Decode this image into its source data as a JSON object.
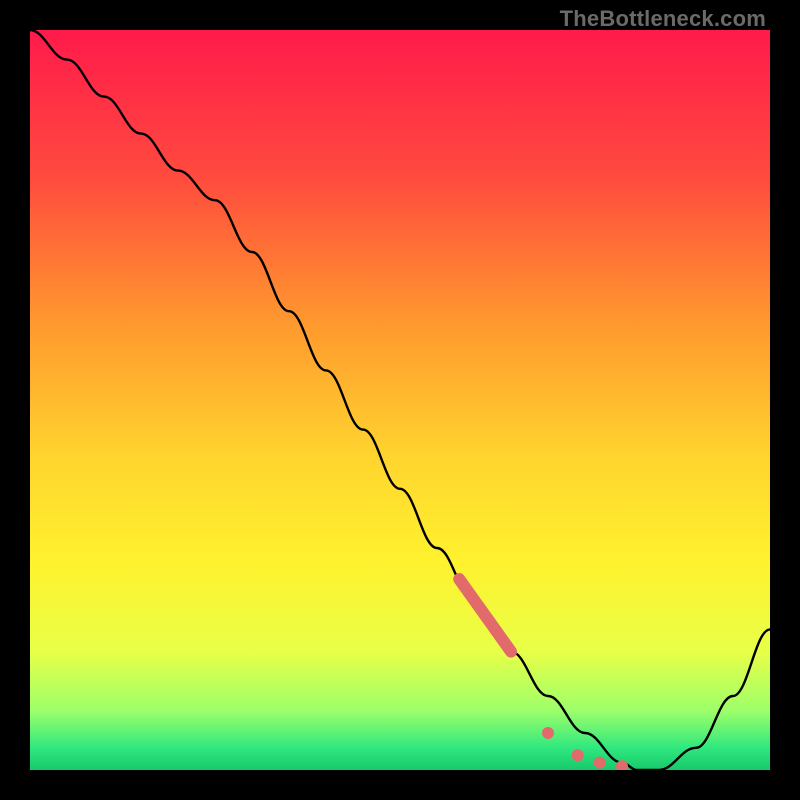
{
  "watermark": "TheBottleneck.com",
  "colors": {
    "frame": "#000000",
    "curve": "#000000",
    "marker": "#e26a6a",
    "gradient_stops": [
      {
        "pct": 0,
        "color": "#ff1a4b"
      },
      {
        "pct": 20,
        "color": "#ff4b3e"
      },
      {
        "pct": 40,
        "color": "#ff9a2e"
      },
      {
        "pct": 58,
        "color": "#ffd52e"
      },
      {
        "pct": 72,
        "color": "#fff22e"
      },
      {
        "pct": 84,
        "color": "#e8ff47"
      },
      {
        "pct": 92,
        "color": "#9dff6a"
      },
      {
        "pct": 97,
        "color": "#30e87e"
      },
      {
        "pct": 100,
        "color": "#17c96b"
      }
    ]
  },
  "chart_data": {
    "type": "line",
    "title": "",
    "xlabel": "",
    "ylabel": "",
    "x": [
      0,
      5,
      10,
      15,
      20,
      25,
      30,
      35,
      40,
      45,
      50,
      55,
      60,
      65,
      70,
      75,
      80,
      82,
      85,
      90,
      95,
      100
    ],
    "y": [
      100,
      96,
      91,
      86,
      81,
      77,
      70,
      62,
      54,
      46,
      38,
      30,
      23,
      16,
      10,
      5,
      1,
      0,
      0,
      3,
      10,
      19
    ],
    "xlim": [
      0,
      100
    ],
    "ylim": [
      0,
      100
    ],
    "markers": {
      "thick_segment": {
        "x_start": 58,
        "x_end": 65,
        "width": 12
      },
      "dots": [
        {
          "x": 70,
          "y": 5
        },
        {
          "x": 74,
          "y": 2
        },
        {
          "x": 77,
          "y": 1
        },
        {
          "x": 80,
          "y": 0.5
        }
      ]
    }
  }
}
